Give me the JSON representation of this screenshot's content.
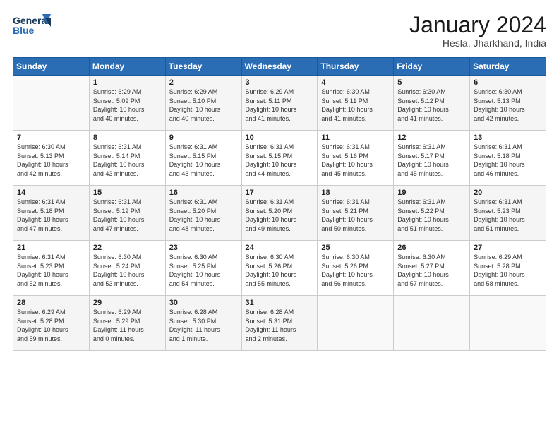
{
  "logo": {
    "line1": "General",
    "line2": "Blue"
  },
  "title": "January 2024",
  "location": "Hesla, Jharkhand, India",
  "headers": [
    "Sunday",
    "Monday",
    "Tuesday",
    "Wednesday",
    "Thursday",
    "Friday",
    "Saturday"
  ],
  "weeks": [
    [
      {
        "day": "",
        "info": ""
      },
      {
        "day": "1",
        "info": "Sunrise: 6:29 AM\nSunset: 5:09 PM\nDaylight: 10 hours\nand 40 minutes."
      },
      {
        "day": "2",
        "info": "Sunrise: 6:29 AM\nSunset: 5:10 PM\nDaylight: 10 hours\nand 40 minutes."
      },
      {
        "day": "3",
        "info": "Sunrise: 6:29 AM\nSunset: 5:11 PM\nDaylight: 10 hours\nand 41 minutes."
      },
      {
        "day": "4",
        "info": "Sunrise: 6:30 AM\nSunset: 5:11 PM\nDaylight: 10 hours\nand 41 minutes."
      },
      {
        "day": "5",
        "info": "Sunrise: 6:30 AM\nSunset: 5:12 PM\nDaylight: 10 hours\nand 41 minutes."
      },
      {
        "day": "6",
        "info": "Sunrise: 6:30 AM\nSunset: 5:13 PM\nDaylight: 10 hours\nand 42 minutes."
      }
    ],
    [
      {
        "day": "7",
        "info": "Sunrise: 6:30 AM\nSunset: 5:13 PM\nDaylight: 10 hours\nand 42 minutes."
      },
      {
        "day": "8",
        "info": "Sunrise: 6:31 AM\nSunset: 5:14 PM\nDaylight: 10 hours\nand 43 minutes."
      },
      {
        "day": "9",
        "info": "Sunrise: 6:31 AM\nSunset: 5:15 PM\nDaylight: 10 hours\nand 43 minutes."
      },
      {
        "day": "10",
        "info": "Sunrise: 6:31 AM\nSunset: 5:15 PM\nDaylight: 10 hours\nand 44 minutes."
      },
      {
        "day": "11",
        "info": "Sunrise: 6:31 AM\nSunset: 5:16 PM\nDaylight: 10 hours\nand 45 minutes."
      },
      {
        "day": "12",
        "info": "Sunrise: 6:31 AM\nSunset: 5:17 PM\nDaylight: 10 hours\nand 45 minutes."
      },
      {
        "day": "13",
        "info": "Sunrise: 6:31 AM\nSunset: 5:18 PM\nDaylight: 10 hours\nand 46 minutes."
      }
    ],
    [
      {
        "day": "14",
        "info": "Sunrise: 6:31 AM\nSunset: 5:18 PM\nDaylight: 10 hours\nand 47 minutes."
      },
      {
        "day": "15",
        "info": "Sunrise: 6:31 AM\nSunset: 5:19 PM\nDaylight: 10 hours\nand 47 minutes."
      },
      {
        "day": "16",
        "info": "Sunrise: 6:31 AM\nSunset: 5:20 PM\nDaylight: 10 hours\nand 48 minutes."
      },
      {
        "day": "17",
        "info": "Sunrise: 6:31 AM\nSunset: 5:20 PM\nDaylight: 10 hours\nand 49 minutes."
      },
      {
        "day": "18",
        "info": "Sunrise: 6:31 AM\nSunset: 5:21 PM\nDaylight: 10 hours\nand 50 minutes."
      },
      {
        "day": "19",
        "info": "Sunrise: 6:31 AM\nSunset: 5:22 PM\nDaylight: 10 hours\nand 51 minutes."
      },
      {
        "day": "20",
        "info": "Sunrise: 6:31 AM\nSunset: 5:23 PM\nDaylight: 10 hours\nand 51 minutes."
      }
    ],
    [
      {
        "day": "21",
        "info": "Sunrise: 6:31 AM\nSunset: 5:23 PM\nDaylight: 10 hours\nand 52 minutes."
      },
      {
        "day": "22",
        "info": "Sunrise: 6:30 AM\nSunset: 5:24 PM\nDaylight: 10 hours\nand 53 minutes."
      },
      {
        "day": "23",
        "info": "Sunrise: 6:30 AM\nSunset: 5:25 PM\nDaylight: 10 hours\nand 54 minutes."
      },
      {
        "day": "24",
        "info": "Sunrise: 6:30 AM\nSunset: 5:26 PM\nDaylight: 10 hours\nand 55 minutes."
      },
      {
        "day": "25",
        "info": "Sunrise: 6:30 AM\nSunset: 5:26 PM\nDaylight: 10 hours\nand 56 minutes."
      },
      {
        "day": "26",
        "info": "Sunrise: 6:30 AM\nSunset: 5:27 PM\nDaylight: 10 hours\nand 57 minutes."
      },
      {
        "day": "27",
        "info": "Sunrise: 6:29 AM\nSunset: 5:28 PM\nDaylight: 10 hours\nand 58 minutes."
      }
    ],
    [
      {
        "day": "28",
        "info": "Sunrise: 6:29 AM\nSunset: 5:28 PM\nDaylight: 10 hours\nand 59 minutes."
      },
      {
        "day": "29",
        "info": "Sunrise: 6:29 AM\nSunset: 5:29 PM\nDaylight: 11 hours\nand 0 minutes."
      },
      {
        "day": "30",
        "info": "Sunrise: 6:28 AM\nSunset: 5:30 PM\nDaylight: 11 hours\nand 1 minute."
      },
      {
        "day": "31",
        "info": "Sunrise: 6:28 AM\nSunset: 5:31 PM\nDaylight: 11 hours\nand 2 minutes."
      },
      {
        "day": "",
        "info": ""
      },
      {
        "day": "",
        "info": ""
      },
      {
        "day": "",
        "info": ""
      }
    ]
  ]
}
